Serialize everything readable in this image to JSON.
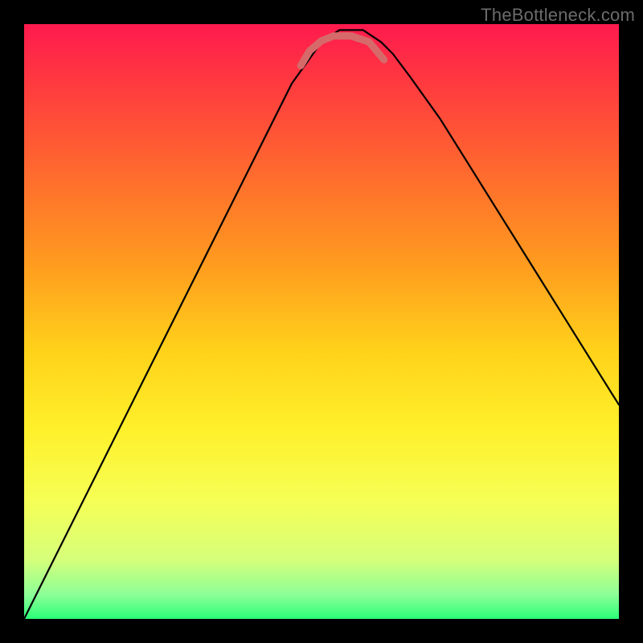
{
  "watermark": "TheBottleneck.com",
  "colors": {
    "frame": "#000000",
    "curve_main": "#000000",
    "curve_highlight": "#d66a6a",
    "gradient_stops": [
      {
        "offset": 0.0,
        "color": "#ff1a4e"
      },
      {
        "offset": 0.1,
        "color": "#ff3a3f"
      },
      {
        "offset": 0.25,
        "color": "#ff6a2e"
      },
      {
        "offset": 0.4,
        "color": "#ff9a1f"
      },
      {
        "offset": 0.55,
        "color": "#ffd21a"
      },
      {
        "offset": 0.68,
        "color": "#fff02a"
      },
      {
        "offset": 0.8,
        "color": "#f6ff55"
      },
      {
        "offset": 0.9,
        "color": "#d6ff7a"
      },
      {
        "offset": 0.96,
        "color": "#8bff97"
      },
      {
        "offset": 1.0,
        "color": "#2bff77"
      }
    ]
  },
  "chart_data": {
    "type": "line",
    "title": "",
    "xlabel": "",
    "ylabel": "",
    "xlim": [
      0,
      1
    ],
    "ylim": [
      0,
      1
    ],
    "y_axis_inverted_display": true,
    "series": [
      {
        "name": "bottleneck-curve",
        "x": [
          0.0,
          0.05,
          0.1,
          0.15,
          0.2,
          0.25,
          0.3,
          0.35,
          0.4,
          0.45,
          0.5,
          0.53,
          0.57,
          0.6,
          0.62,
          0.65,
          0.7,
          0.75,
          0.8,
          0.85,
          0.9,
          0.95,
          1.0
        ],
        "y": [
          1.0,
          0.9,
          0.8,
          0.7,
          0.6,
          0.5,
          0.4,
          0.3,
          0.2,
          0.1,
          0.03,
          0.01,
          0.01,
          0.03,
          0.05,
          0.09,
          0.16,
          0.24,
          0.32,
          0.4,
          0.48,
          0.56,
          0.64
        ]
      },
      {
        "name": "bottom-highlight",
        "x": [
          0.465,
          0.48,
          0.5,
          0.52,
          0.55,
          0.58,
          0.605
        ],
        "y": [
          0.07,
          0.045,
          0.028,
          0.02,
          0.02,
          0.03,
          0.06
        ]
      }
    ],
    "annotations": [
      {
        "text": "TheBottleneck.com",
        "position": "top-right"
      }
    ]
  }
}
